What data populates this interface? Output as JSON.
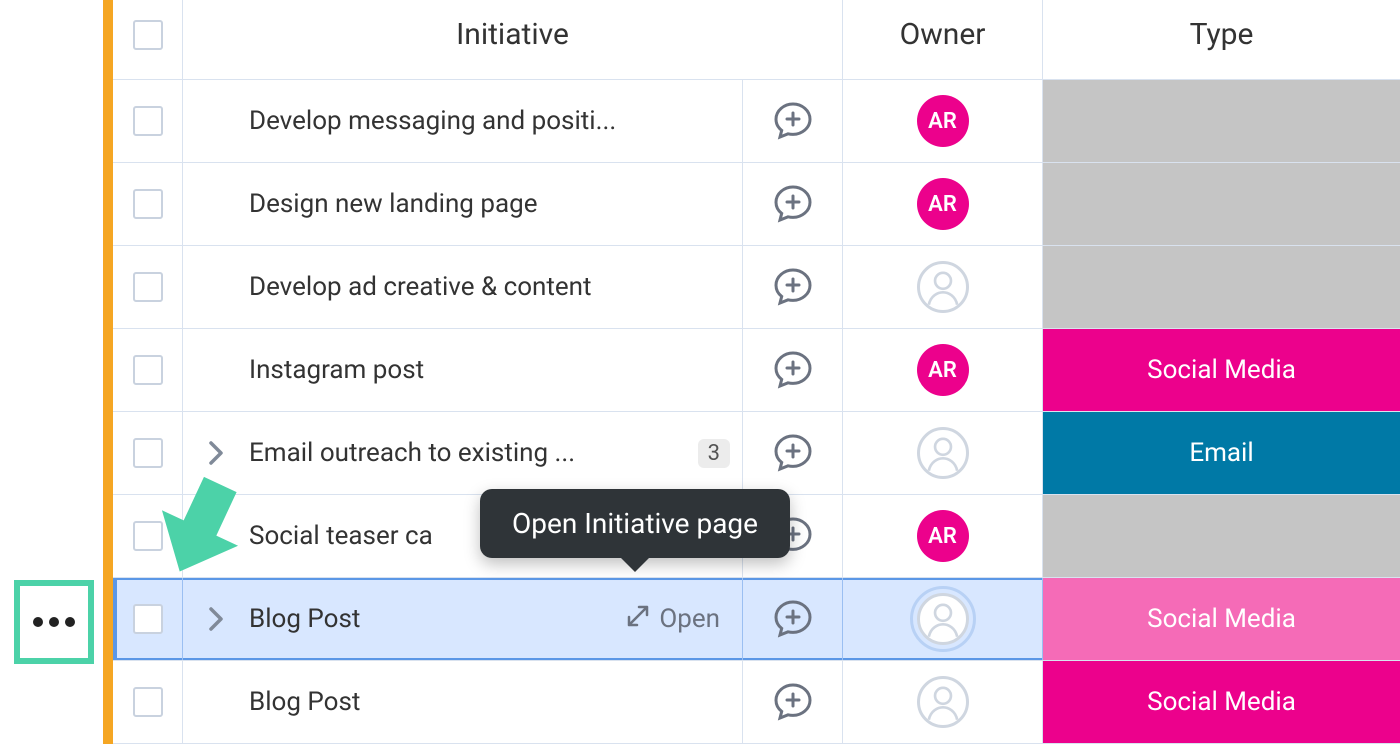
{
  "columns": {
    "initiative": "Initiative",
    "owner": "Owner",
    "type": "Type"
  },
  "tooltip": "Open Initiative page",
  "open_label": "Open",
  "avatar_initials": "AR",
  "rows": [
    {
      "title": "Develop messaging and positi...",
      "expandable": false,
      "count": null,
      "owner": "AR",
      "type_label": "",
      "type_style": "gray",
      "selected": false
    },
    {
      "title": "Design new landing page",
      "expandable": false,
      "count": null,
      "owner": "AR",
      "type_label": "",
      "type_style": "gray",
      "selected": false
    },
    {
      "title": "Develop ad creative & content",
      "expandable": false,
      "count": null,
      "owner": null,
      "type_label": "",
      "type_style": "gray",
      "selected": false
    },
    {
      "title": "Instagram post",
      "expandable": false,
      "count": null,
      "owner": "AR",
      "type_label": "Social Media",
      "type_style": "pink",
      "selected": false
    },
    {
      "title": "Email outreach to existing ...",
      "expandable": true,
      "count": "3",
      "owner": null,
      "type_label": "Email",
      "type_style": "blue",
      "selected": false
    },
    {
      "title": "Social teaser ca",
      "expandable": false,
      "count": null,
      "owner": "AR",
      "type_label": "",
      "type_style": "gray",
      "selected": false
    },
    {
      "title": "Blog Post",
      "expandable": true,
      "count": null,
      "owner": null,
      "type_label": "Social Media",
      "type_style": "lpink",
      "selected": true
    },
    {
      "title": "Blog Post",
      "expandable": false,
      "count": null,
      "owner": null,
      "type_label": "Social Media",
      "type_style": "pink",
      "selected": false
    }
  ]
}
